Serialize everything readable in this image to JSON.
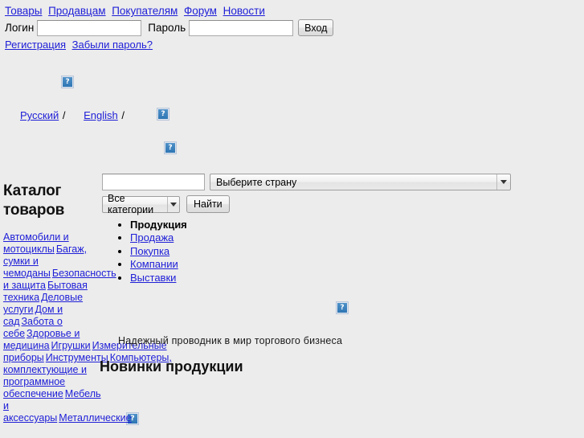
{
  "topnav": {
    "items": [
      {
        "label": "Товары"
      },
      {
        "label": "Продавцам"
      },
      {
        "label": "Покупателям"
      },
      {
        "label": "Форум"
      },
      {
        "label": "Новости"
      }
    ]
  },
  "login": {
    "login_label": "Логин",
    "login_value": "",
    "password_label": "Пароль",
    "password_value": "",
    "submit_label": "Вход"
  },
  "subnav": {
    "items": [
      {
        "label": "Регистрация"
      },
      {
        "label": "Забыли пароль?"
      }
    ]
  },
  "placeholders": {
    "icon_name": "broken-image-icon",
    "glyph": "?"
  },
  "language": {
    "separator": "/",
    "items": [
      {
        "label": "Русский"
      },
      {
        "label": "English"
      },
      {
        "label": ""
      }
    ]
  },
  "sidebar": {
    "title": "Каталог товаров",
    "categories": [
      {
        "label": "Автомобили и мотоциклы"
      },
      {
        "label": "Багаж, сумки и чемоданы"
      },
      {
        "label": "Безопасность и защита"
      },
      {
        "label": "Бытовая техника"
      },
      {
        "label": "Деловые услуги"
      },
      {
        "label": "Дом и сад"
      },
      {
        "label": "Забота о себе"
      },
      {
        "label": "Здоровье и медицина"
      },
      {
        "label": "Игрушки"
      },
      {
        "label": "Измерительные приборы"
      },
      {
        "label": "Инструменты"
      },
      {
        "label": "Компьютеры, комплектующие и программное обеспечение"
      },
      {
        "label": "Мебель и аксессуары"
      },
      {
        "label": "Металлические"
      }
    ]
  },
  "search": {
    "query_value": "",
    "country_selected": "Выберите страну",
    "category_selected": "Все категории",
    "find_label": "Найти"
  },
  "menu": {
    "items": [
      {
        "label": "Продукция",
        "active": true
      },
      {
        "label": "Продажа",
        "active": false
      },
      {
        "label": "Покупка",
        "active": false
      },
      {
        "label": "Компании",
        "active": false
      },
      {
        "label": "Выставки",
        "active": false
      }
    ]
  },
  "main": {
    "tagline": "Надежный проводник в мир торгового бизнеса",
    "news_heading": "Новинки продукции"
  },
  "colors": {
    "page_background": "#ececec",
    "link": "#2020d8",
    "text": "#000000",
    "placeholder_border": "#b9c6da",
    "placeholder_fill": "#2f76b4"
  }
}
